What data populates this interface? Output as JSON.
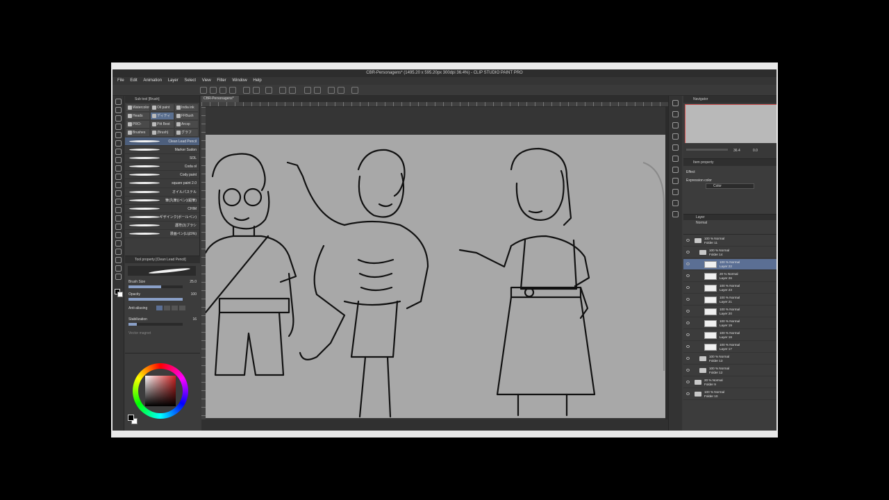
{
  "window": {
    "title": "CBR-Personagens* (1495.20 x 595.20px 300dpi 36.4%) - CLIP STUDIO PAINT PRO"
  },
  "menu": [
    "File",
    "Edit",
    "Animation",
    "Layer",
    "Select",
    "View",
    "Filter",
    "Window",
    "Help"
  ],
  "canvas_tab": "CBR-Personagens*",
  "subtool": {
    "header": "Sub tool [Brush]",
    "groups": [
      "Watercolor",
      "Oil paint",
      "India ink",
      "Heads",
      "ディティ",
      "FFBush",
      "PRO-",
      "Pitt Best",
      "Arcsp",
      "Brushes",
      "(Brush)",
      "グラフ"
    ],
    "brushes": [
      "Clean Lead Pencil",
      "Marker Sudon",
      "SOL",
      "Coda ol",
      "Cody paint",
      "square paint 2.0",
      "オイルパステル",
      "筆(丸筆)(ペン)(鉛筆)",
      "CHIM",
      "ギザインク(ボールペン)",
      "護符(3)ブラシ",
      "漫画ペン(Lは5%)"
    ]
  },
  "tool_property": {
    "header": "Tool property [Clean Lead Pencil]",
    "brush_size_label": "Brush Size",
    "brush_size_value": "25.0",
    "opacity_label": "Opacity",
    "opacity_value": "100",
    "antialias_label": "Anti-aliasing",
    "stabilization_label": "Stabilization",
    "stabilization_value": "16",
    "vector_label": "Vector magnet"
  },
  "navigator": {
    "header": "Navigator",
    "zoom": "36.4",
    "angle": "0.0"
  },
  "sub_view": {
    "header": "Item property",
    "effect_label": "Effect",
    "expression_label": "Expression color",
    "expression_value": "Color"
  },
  "layers": {
    "header": "Layer",
    "blend_mode": "Normal",
    "items": [
      {
        "kind": "folder",
        "indent": 0,
        "line1": "100 % Normal",
        "line2": "Folder 11",
        "active": false
      },
      {
        "kind": "folder",
        "indent": 1,
        "line1": "100 % Normal",
        "line2": "Folder 14",
        "active": false
      },
      {
        "kind": "layer",
        "indent": 2,
        "line1": "100 % Normal",
        "line2": "Layer 22",
        "active": true
      },
      {
        "kind": "layer",
        "indent": 2,
        "line1": "20 % Normal",
        "line2": "Layer 26",
        "active": false
      },
      {
        "kind": "layer",
        "indent": 2,
        "line1": "100 % Normal",
        "line2": "Layer 23",
        "active": false
      },
      {
        "kind": "layer",
        "indent": 2,
        "line1": "100 % Normal",
        "line2": "Layer 21",
        "active": false
      },
      {
        "kind": "layer",
        "indent": 2,
        "line1": "100 % Normal",
        "line2": "Layer 20",
        "active": false
      },
      {
        "kind": "layer",
        "indent": 2,
        "line1": "100 % Normal",
        "line2": "Layer 19",
        "active": false
      },
      {
        "kind": "layer",
        "indent": 2,
        "line1": "100 % Normal",
        "line2": "Layer 18",
        "active": false
      },
      {
        "kind": "layer",
        "indent": 2,
        "line1": "100 % Normal",
        "line2": "Layer 17",
        "active": false
      },
      {
        "kind": "folder",
        "indent": 1,
        "line1": "100 % Normal",
        "line2": "Folder 13",
        "active": false
      },
      {
        "kind": "folder",
        "indent": 1,
        "line1": "100 % Normal",
        "line2": "Folder 12",
        "active": false
      },
      {
        "kind": "folder",
        "indent": 0,
        "line1": "20 % Normal",
        "line2": "Folder 9",
        "active": false
      },
      {
        "kind": "folder",
        "indent": 0,
        "line1": "100 % Normal",
        "line2": "Folder 10",
        "active": false
      }
    ]
  },
  "colors": {
    "app_bg": "#3b3b3b",
    "panel_bg": "#3c3c3c",
    "selection": "#5b6f94",
    "canvas": "#a8a8a8"
  }
}
